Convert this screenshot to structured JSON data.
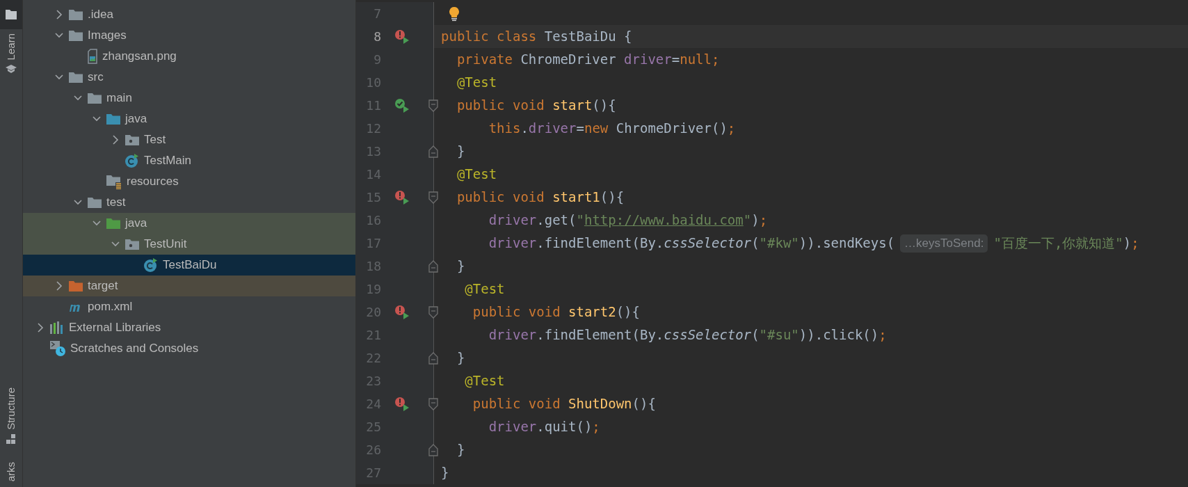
{
  "tool_strip": {
    "top": [
      {
        "kind": "project",
        "selected": true
      },
      {
        "kind": "learn",
        "label": "Learn",
        "selected": false
      }
    ],
    "bottom": [
      {
        "kind": "structure",
        "label": "Structure",
        "selected": false
      },
      {
        "kind": "bookmarks",
        "label": "arks",
        "selected": false
      }
    ]
  },
  "project_tree": {
    "items": [
      {
        "label": ".idea",
        "kind": "folder",
        "expanded": false
      },
      {
        "label": "Images",
        "kind": "folder",
        "expanded": true,
        "children": [
          {
            "label": "zhangsan.png",
            "kind": "image-file"
          }
        ]
      },
      {
        "label": "src",
        "kind": "folder",
        "expanded": true,
        "children": [
          {
            "label": "main",
            "kind": "folder",
            "expanded": true,
            "children": [
              {
                "label": "java",
                "kind": "source-folder",
                "expanded": true,
                "children": [
                  {
                    "label": "Test",
                    "kind": "package",
                    "expanded": false
                  },
                  {
                    "label": "TestMain",
                    "kind": "class"
                  }
                ]
              },
              {
                "label": "resources",
                "kind": "resources-folder"
              }
            ]
          },
          {
            "label": "test",
            "kind": "folder",
            "expanded": true,
            "children": [
              {
                "label": "java",
                "kind": "test-folder",
                "test_scope": true,
                "expanded": true,
                "children": [
                  {
                    "label": "TestUnit",
                    "kind": "package",
                    "test_scope": true,
                    "expanded": true,
                    "children": [
                      {
                        "label": "TestBaiDu",
                        "kind": "class",
                        "selected": true
                      }
                    ]
                  }
                ]
              }
            ]
          }
        ]
      },
      {
        "label": "target",
        "kind": "excluded-folder",
        "excluded": true,
        "expanded": false
      },
      {
        "label": "pom.xml",
        "kind": "maven-file"
      }
    ],
    "root_items": [
      {
        "label": "External Libraries",
        "kind": "libraries",
        "expanded": false
      },
      {
        "label": "Scratches and Consoles",
        "kind": "scratches"
      }
    ]
  },
  "editor": {
    "lines": [
      {
        "number": "7",
        "bulb": true
      },
      {
        "number": "8",
        "current": true,
        "marker": {
          "kind": "run-failed"
        },
        "tokens": [
          {
            "kind": "kw",
            "t": "public class "
          },
          {
            "kind": "plain",
            "t": "TestBaiDu {"
          }
        ]
      },
      {
        "number": "9",
        "tokens": [
          {
            "kind": "kw",
            "t": "  private "
          },
          {
            "kind": "plain",
            "t": "ChromeDriver "
          },
          {
            "kind": "field",
            "t": "driver"
          },
          {
            "kind": "plain",
            "t": "="
          },
          {
            "kind": "kw",
            "t": "null;"
          }
        ]
      },
      {
        "number": "10",
        "tokens": [
          {
            "kind": "ann",
            "t": "  @Test"
          }
        ]
      },
      {
        "number": "11",
        "marker": {
          "kind": "run-passed"
        },
        "fold": {
          "kind": "start"
        },
        "tokens": [
          {
            "kind": "kw",
            "t": "  public void "
          },
          {
            "kind": "method",
            "t": "start"
          },
          {
            "kind": "plain",
            "t": "(){"
          }
        ]
      },
      {
        "number": "12",
        "tokens": [
          {
            "kind": "kw",
            "t": "      this"
          },
          {
            "kind": "plain",
            "t": "."
          },
          {
            "kind": "field",
            "t": "driver"
          },
          {
            "kind": "plain",
            "t": "="
          },
          {
            "kind": "kw",
            "t": "new "
          },
          {
            "kind": "plain",
            "t": "ChromeDriver()"
          },
          {
            "kind": "kw",
            "t": ";"
          }
        ]
      },
      {
        "number": "13",
        "fold": {
          "kind": "end"
        },
        "tokens": [
          {
            "kind": "plain",
            "t": "  }"
          }
        ]
      },
      {
        "number": "14",
        "tokens": [
          {
            "kind": "ann",
            "t": "  @Test"
          }
        ]
      },
      {
        "number": "15",
        "marker": {
          "kind": "run-failed"
        },
        "fold": {
          "kind": "start"
        },
        "tokens": [
          {
            "kind": "kw",
            "t": "  public void "
          },
          {
            "kind": "method",
            "t": "start1"
          },
          {
            "kind": "plain",
            "t": "(){"
          }
        ]
      },
      {
        "number": "16",
        "tokens": [
          {
            "kind": "field",
            "t": "      driver"
          },
          {
            "kind": "plain",
            "t": ".get("
          },
          {
            "kind": "str",
            "t": "\""
          },
          {
            "kind": "link",
            "t": "http://www.baidu.com"
          },
          {
            "kind": "str",
            "t": "\""
          },
          {
            "kind": "plain",
            "t": ")"
          },
          {
            "kind": "kw",
            "t": ";"
          }
        ]
      },
      {
        "number": "17",
        "tokens": [
          {
            "kind": "field",
            "t": "      driver"
          },
          {
            "kind": "plain",
            "t": ".findElement(By."
          },
          {
            "kind": "italic",
            "t": "cssSelector"
          },
          {
            "kind": "plain",
            "t": "("
          },
          {
            "kind": "str",
            "t": "\"#kw\""
          },
          {
            "kind": "plain",
            "t": ")).sendKeys("
          },
          {
            "kind": "hint",
            "t": "…keysToSend:"
          },
          {
            "kind": "str",
            "t": "\"百度一下,你就知道\""
          },
          {
            "kind": "plain",
            "t": ")"
          },
          {
            "kind": "kw",
            "t": ";"
          }
        ]
      },
      {
        "number": "18",
        "fold": {
          "kind": "end"
        },
        "tokens": [
          {
            "kind": "plain",
            "t": "  }"
          }
        ]
      },
      {
        "number": "19",
        "tokens": [
          {
            "kind": "ann",
            "t": "   @Test"
          }
        ]
      },
      {
        "number": "20",
        "marker": {
          "kind": "run-failed"
        },
        "fold": {
          "kind": "start"
        },
        "tokens": [
          {
            "kind": "kw",
            "t": "    public void "
          },
          {
            "kind": "method",
            "t": "start2"
          },
          {
            "kind": "plain",
            "t": "(){"
          }
        ]
      },
      {
        "number": "21",
        "tokens": [
          {
            "kind": "field",
            "t": "      driver"
          },
          {
            "kind": "plain",
            "t": ".findElement(By."
          },
          {
            "kind": "italic",
            "t": "cssSelector"
          },
          {
            "kind": "plain",
            "t": "("
          },
          {
            "kind": "str",
            "t": "\"#su\""
          },
          {
            "kind": "plain",
            "t": ")).click()"
          },
          {
            "kind": "kw",
            "t": ";"
          }
        ]
      },
      {
        "number": "22",
        "fold": {
          "kind": "end"
        },
        "tokens": [
          {
            "kind": "plain",
            "t": "  }"
          }
        ]
      },
      {
        "number": "23",
        "tokens": [
          {
            "kind": "ann",
            "t": "   @Test"
          }
        ]
      },
      {
        "number": "24",
        "marker": {
          "kind": "run-failed"
        },
        "fold": {
          "kind": "start"
        },
        "tokens": [
          {
            "kind": "kw",
            "t": "    public void "
          },
          {
            "kind": "method",
            "t": "ShutDown"
          },
          {
            "kind": "plain",
            "t": "(){"
          }
        ]
      },
      {
        "number": "25",
        "tokens": [
          {
            "kind": "field",
            "t": "      driver"
          },
          {
            "kind": "plain",
            "t": ".quit()"
          },
          {
            "kind": "kw",
            "t": ";"
          }
        ]
      },
      {
        "number": "26",
        "fold": {
          "kind": "end"
        },
        "tokens": [
          {
            "kind": "plain",
            "t": "  }"
          }
        ]
      },
      {
        "number": "27",
        "tokens": [
          {
            "kind": "plain",
            "t": "}"
          }
        ]
      }
    ]
  }
}
